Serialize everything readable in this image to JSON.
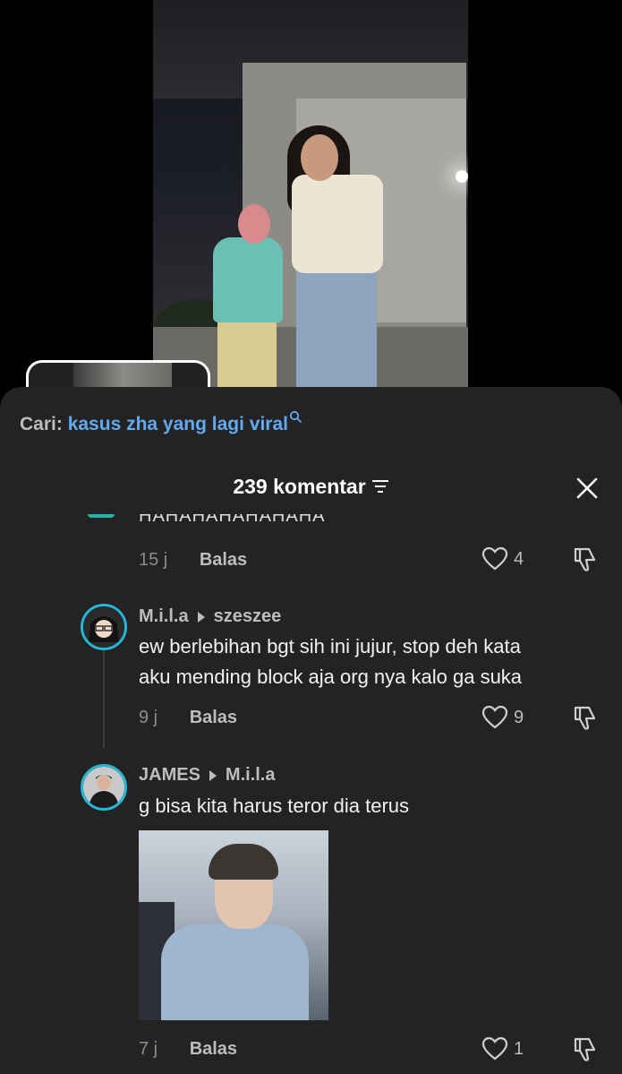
{
  "search": {
    "label": "Cari:",
    "term": "kasus zha yang lagi viral"
  },
  "header": {
    "title": "239 komentar"
  },
  "partial_comment": {
    "text": "HAHAHAHAHAHAHA",
    "time": "15 j",
    "reply_label": "Balas",
    "likes": "4"
  },
  "comments": [
    {
      "author": "M.i.l.a",
      "reply_to": "szeszee",
      "text_line1": "ew berlebihan bgt sih ini jujur, stop deh kata",
      "text_line2": "aku mending block aja org nya kalo ga suka",
      "time": "9 j",
      "reply_label": "Balas",
      "likes": "9"
    },
    {
      "author": "JAMES",
      "reply_to": "M.i.l.a",
      "text": "g bisa kita harus teror dia terus",
      "time": "7 j",
      "reply_label": "Balas",
      "likes": "1"
    }
  ],
  "colors": {
    "accent_blue": "#63a9ee",
    "sheet_bg": "#232323",
    "avatar_ring": "#24b7d6"
  },
  "icons": [
    "search-icon",
    "filter-icon",
    "close-icon",
    "heart-icon",
    "dislike-icon"
  ]
}
